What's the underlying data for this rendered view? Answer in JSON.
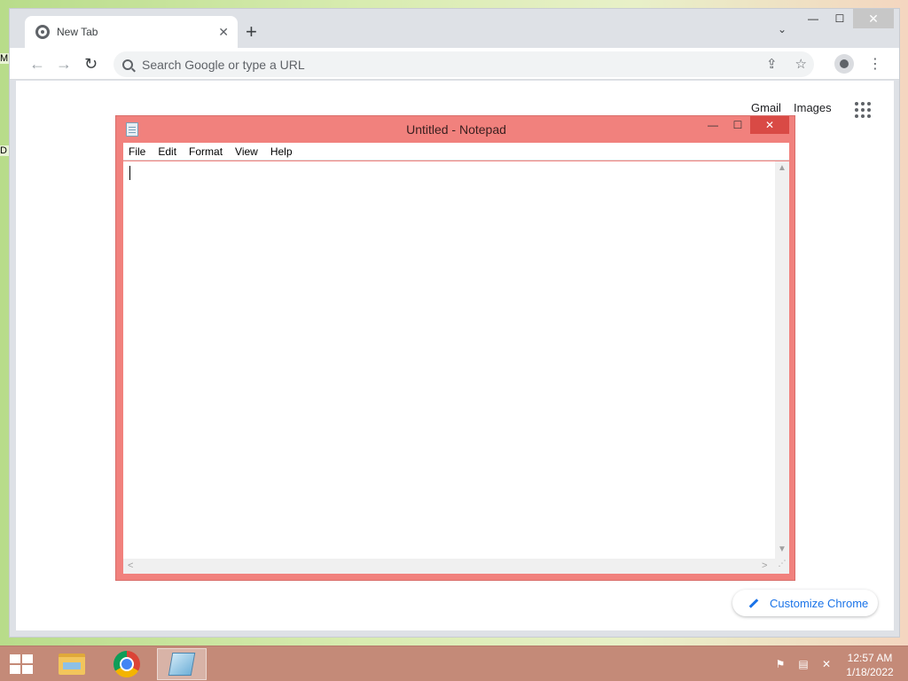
{
  "desktop": {
    "icon_labels": [
      "M",
      "D"
    ]
  },
  "chrome": {
    "tab": {
      "title": "New Tab",
      "close_glyph": "✕"
    },
    "new_tab_glyph": "+",
    "tab_search_glyph": "⌄",
    "window_controls": {
      "minimize": "—",
      "maximize": "☐",
      "close": "✕"
    },
    "nav": {
      "back": "←",
      "forward": "→",
      "reload": "↻"
    },
    "omnibox": {
      "placeholder": "Search Google or type a URL",
      "value": ""
    },
    "omnibox_icons": {
      "share": "⇪",
      "bookmark": "☆"
    },
    "menu_glyph": "⋮",
    "ntp": {
      "gmail": "Gmail",
      "images": "Images",
      "customize": "Customize Chrome"
    }
  },
  "notepad": {
    "title": "Untitled - Notepad",
    "menu": [
      {
        "label": "File"
      },
      {
        "label": "Edit"
      },
      {
        "label": "Format"
      },
      {
        "label": "View"
      },
      {
        "label": "Help"
      }
    ],
    "content": "",
    "controls": {
      "minimize": "—",
      "maximize": "☐",
      "close": "✕"
    },
    "scroll_glyphs": {
      "up": "▲",
      "down": "▼",
      "left": "<",
      "right": ">"
    }
  },
  "taskbar": {
    "items": [
      "file-explorer",
      "google-chrome",
      "notepad"
    ],
    "active_item": "notepad",
    "tray_glyphs": {
      "flag": "⚑",
      "network": "▤",
      "volume": "✕"
    },
    "clock": {
      "time": "12:57 AM",
      "date": "1/18/2022"
    }
  },
  "colors": {
    "notepad_frame": "#f1817d",
    "taskbar": "#c48a78",
    "chrome_accent": "#1a73e8"
  }
}
